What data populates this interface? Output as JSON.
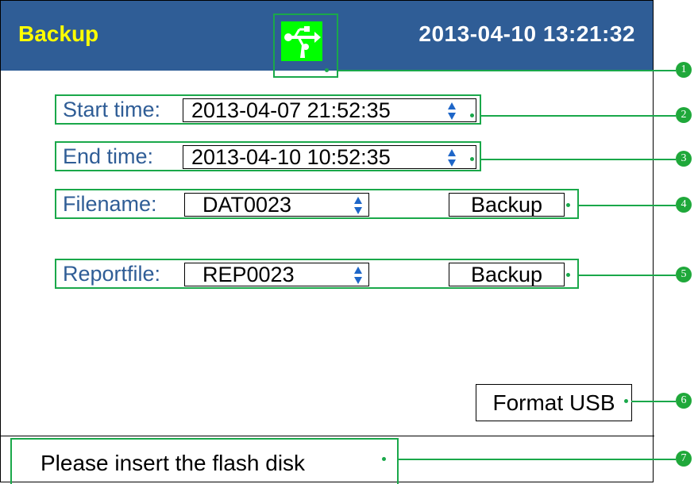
{
  "header": {
    "title": "Backup",
    "datetime": "2013-04-10  13:21:32",
    "usb_icon": "usb-icon"
  },
  "fields": {
    "start_label": "Start time:",
    "start_value": "2013-04-07  21:52:35",
    "end_label": "End time:",
    "end_value": "2013-04-10  10:52:35",
    "filename_label": "Filename:",
    "filename_value": "DAT0023",
    "reportfile_label": "Reportfile:",
    "reportfile_value": "REP0023",
    "backup_label": "Backup"
  },
  "format_button": "Format USB",
  "status": "Please insert the flash disk",
  "callouts": [
    "1",
    "2",
    "3",
    "4",
    "5",
    "6",
    "7"
  ],
  "colors": {
    "header_bg": "#2f5d96",
    "title": "#ffff00",
    "accent_green": "#1aa84a",
    "usb_bg": "#00ff00"
  }
}
